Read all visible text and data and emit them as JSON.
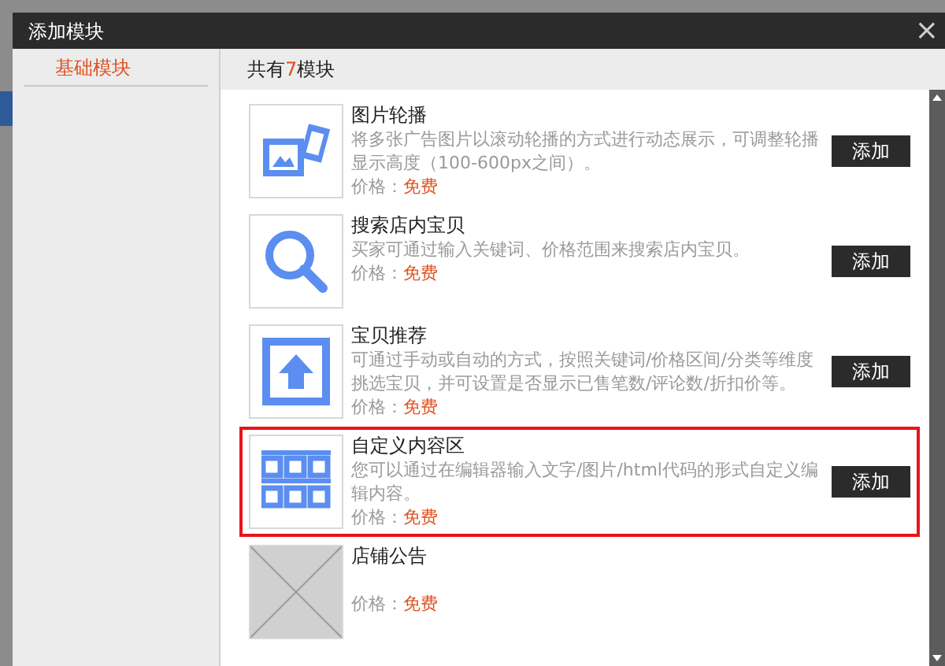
{
  "dialog": {
    "title": "添加模块",
    "close": "×"
  },
  "sidebar": {
    "items": [
      {
        "label": "基础模块",
        "selected": true
      }
    ]
  },
  "header": {
    "text": "共有**7**模块"
  },
  "modules": [
    {
      "kind": "image",
      "title": "图片轮播",
      "description": "将多张广告图片以滚动轮播的方式进行动态展示，可调整轮播显示高度（100-600px之间）。",
      "price_label": "价格：",
      "price": "免费",
      "button": "添加",
      "highlighted": false
    },
    {
      "kind": "search",
      "title": "搜索店内宝贝",
      "description": "买家可通过输入关键词、价格范围来搜索店内宝贝。",
      "price_label": "价格：",
      "price": "免费",
      "button": "添加",
      "highlighted": false
    },
    {
      "kind": "upload",
      "title": "宝贝推荐",
      "description": "可通过手动或自动的方式，按照关键词/价格区间/分类等维度挑选宝贝，并可设置是否显示已售笔数/评论数/折扣价等。",
      "price_label": "价格：",
      "price": "免费",
      "button": "添加",
      "highlighted": false
    },
    {
      "kind": "grid",
      "title": "自定义内容区",
      "description": "您可以通过在编辑器输入文字/图片/html代码的形式自定义编辑内容。",
      "price_label": "价格：",
      "price": "免费",
      "button": "添加",
      "highlighted": true
    },
    {
      "kind": "placeholder",
      "title": "店铺公告",
      "price_label": "价格：",
      "price": "免费",
      "highlighted": false
    }
  ]
}
